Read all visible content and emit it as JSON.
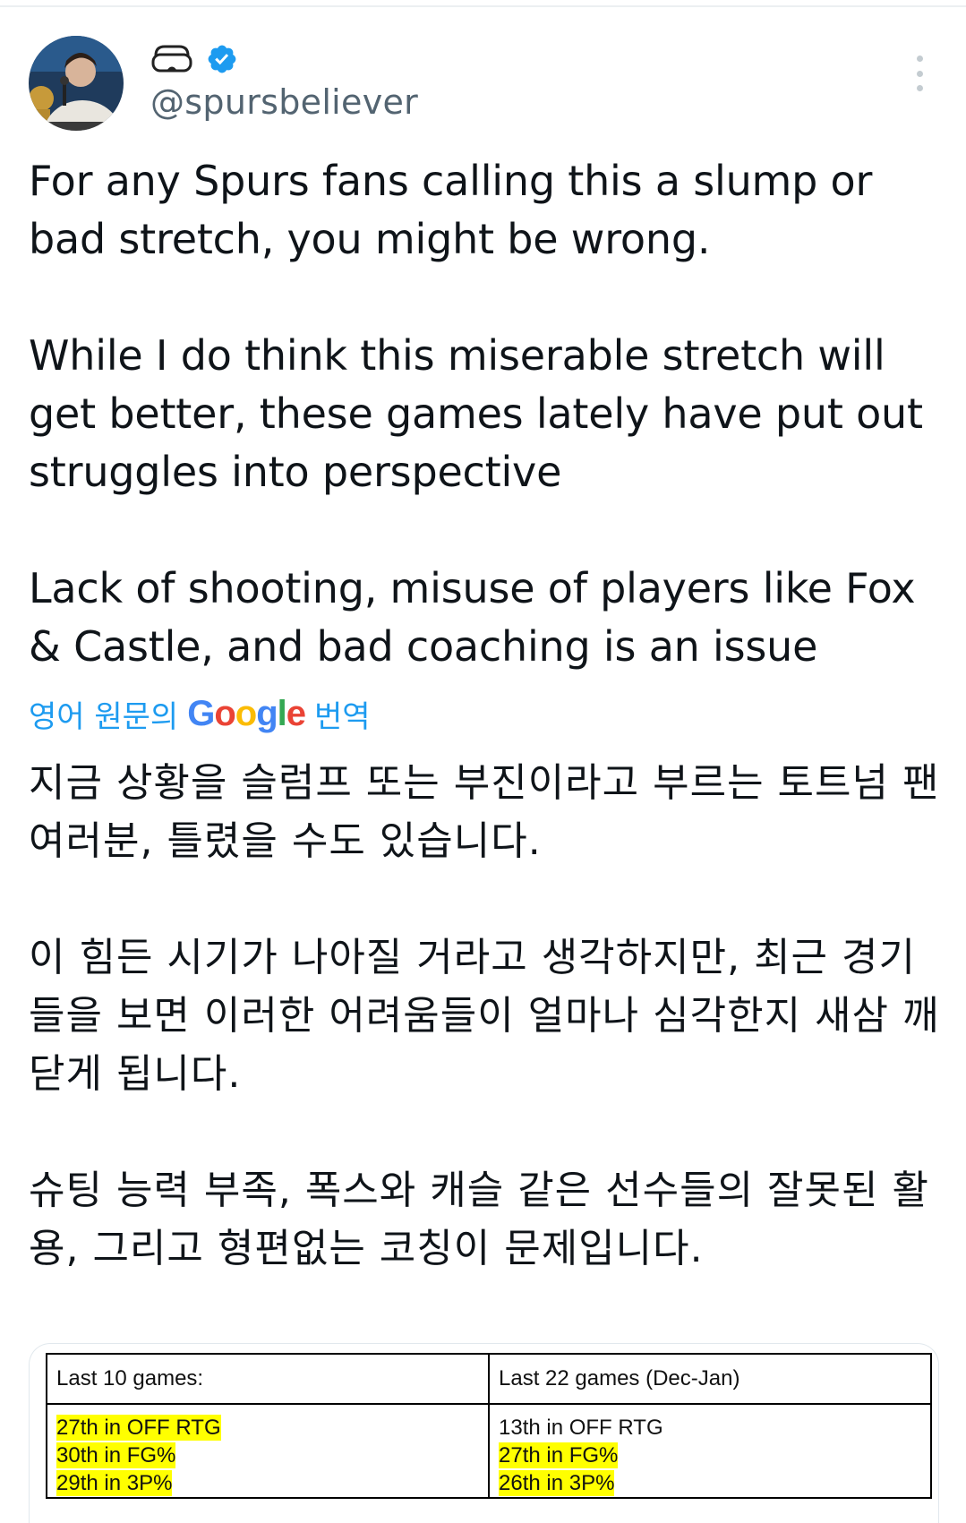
{
  "tweet": {
    "display_name_icon": "vr-headset-icon",
    "verified_icon": "verified-badge-icon",
    "handle": "@spursbeliever",
    "paragraphs": [
      "For any Spurs fans calling this a slump or bad stretch, you might be wrong.",
      "While I do think this miserable stretch will get better, these games lately have put out struggles into perspective",
      "Lack of shooting, misuse of players like Fox & Castle, and bad coaching is an issue"
    ]
  },
  "translation": {
    "prefix": "영어 원문의",
    "provider": "Google",
    "suffix": "번역",
    "paragraphs": [
      "지금 상황을 슬럼프 또는 부진이라고 부르는 토트넘 팬 여러분, 틀렸을 수도 있습니다.",
      "이 힘든 시기가 나아질 거라고 생각하지만, 최근 경기들을 보면 이러한 어려움들이 얼마나 심각한지 새삼 깨닫게 됩니다.",
      "슈팅 능력 부족, 폭스와 캐슬 같은 선수들의 잘못된 활용, 그리고 형편없는 코칭이 문제입니다."
    ]
  },
  "media_table": {
    "columns": [
      {
        "header": "Last 10 games:",
        "rows": [
          {
            "text": "27th in OFF RTG",
            "highlighted": true
          },
          {
            "text": "30th in FG%",
            "highlighted": true
          },
          {
            "text": "29th in 3P%",
            "highlighted": true
          }
        ]
      },
      {
        "header": "Last 22 games (Dec-Jan)",
        "rows": [
          {
            "text": "13th in OFF RTG",
            "highlighted": false
          },
          {
            "text": "27th in FG%",
            "highlighted": true
          },
          {
            "text": "26th in 3P%",
            "highlighted": true
          }
        ]
      }
    ]
  },
  "colors": {
    "link_blue": "#1d9bf0",
    "verified_blue": "#1d9bf0",
    "muted_text": "#536471",
    "highlight_yellow": "#ffff00"
  }
}
